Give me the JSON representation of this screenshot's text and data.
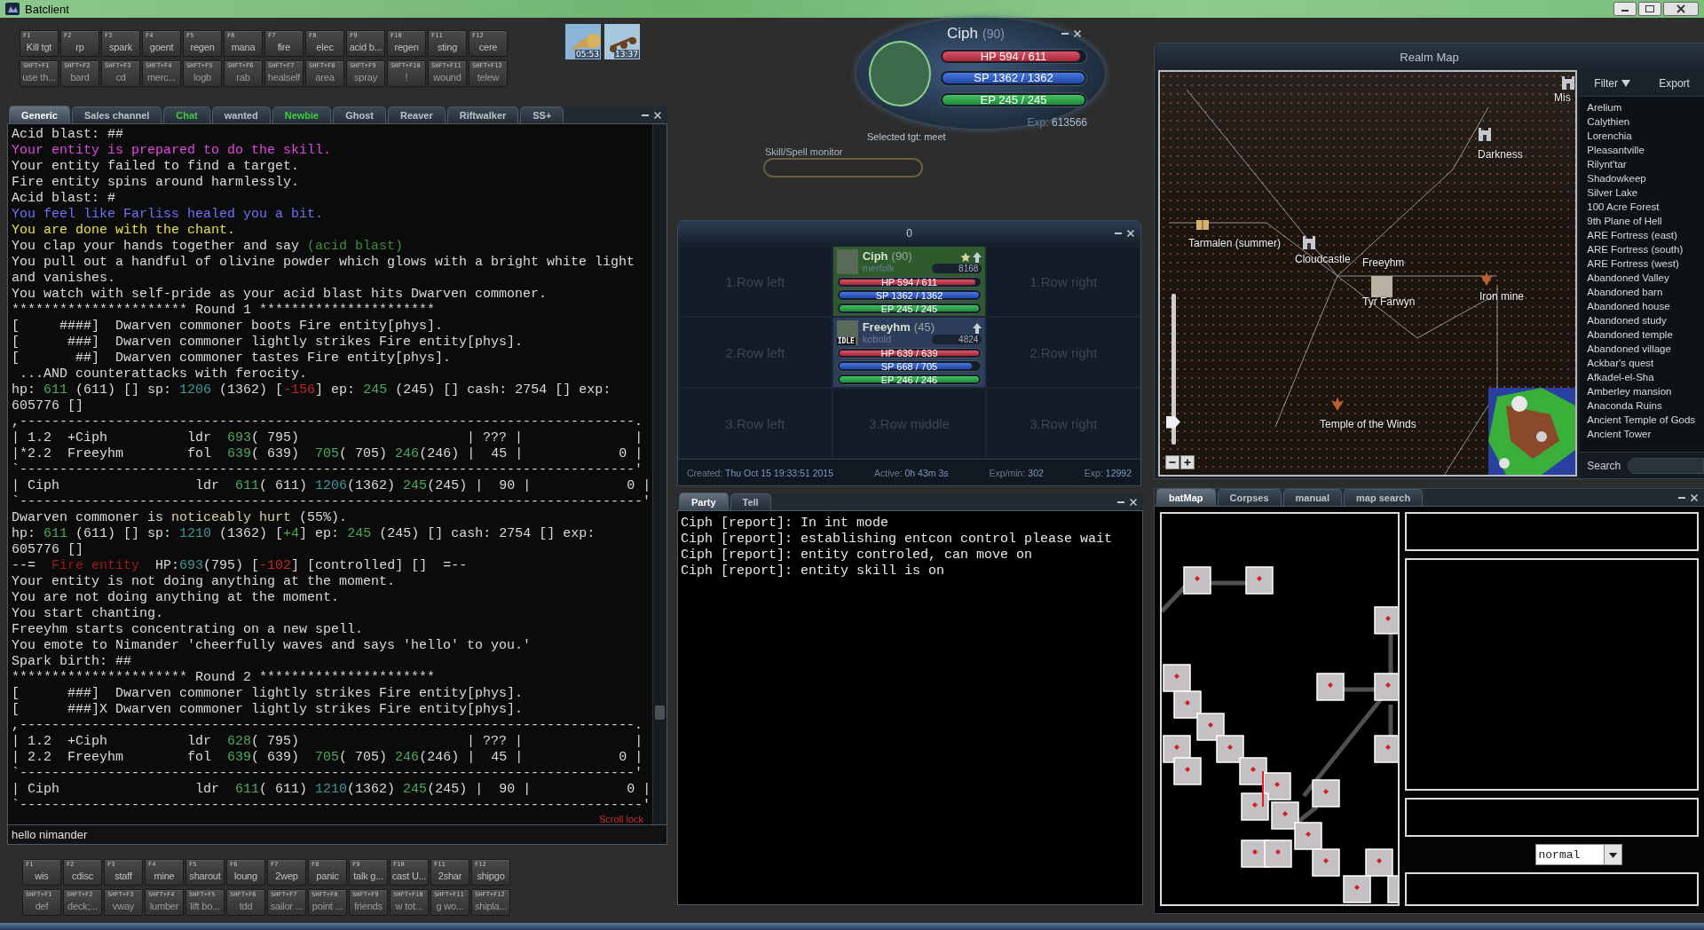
{
  "window": {
    "title": "Batclient"
  },
  "hotkeys_top": {
    "keys": [
      {
        "key": "F1",
        "label": "Kill tgt"
      },
      {
        "key": "F2",
        "label": "rp"
      },
      {
        "key": "F3",
        "label": "spark"
      },
      {
        "key": "F4",
        "label": "goent"
      },
      {
        "key": "F5",
        "label": "regen"
      },
      {
        "key": "F6",
        "label": "mana"
      },
      {
        "key": "F7",
        "label": "fire"
      },
      {
        "key": "F8",
        "label": "elec"
      },
      {
        "key": "F9",
        "label": "acid b..."
      },
      {
        "key": "F10",
        "label": "regen"
      },
      {
        "key": "F11",
        "label": "sting"
      },
      {
        "key": "F12",
        "label": "cere"
      }
    ],
    "shift_keys": [
      {
        "key": "SHFT+F1",
        "label": "use th..."
      },
      {
        "key": "SHFT+F2",
        "label": "bard"
      },
      {
        "key": "SHFT+F3",
        "label": "cd"
      },
      {
        "key": "SHFT+F4",
        "label": "merc..."
      },
      {
        "key": "SHFT+F5",
        "label": "logb"
      },
      {
        "key": "SHFT+F6",
        "label": "rab"
      },
      {
        "key": "SHFT+F7",
        "label": "healself"
      },
      {
        "key": "SHFT+F8",
        "label": "area"
      },
      {
        "key": "SHFT+F9",
        "label": "spray"
      },
      {
        "key": "SHFT+F10",
        "label": "!"
      },
      {
        "key": "SHFT+F11",
        "label": "wound"
      },
      {
        "key": "SHFT+F12",
        "label": "telew"
      }
    ]
  },
  "quick_icons": [
    {
      "timer": "05:53"
    },
    {
      "timer": "13:37"
    }
  ],
  "channel_tabs": [
    {
      "label": "Generic",
      "selected": true,
      "highlighted": false
    },
    {
      "label": "Sales channel",
      "selected": false,
      "highlighted": false
    },
    {
      "label": "Chat",
      "selected": false,
      "highlighted": true
    },
    {
      "label": "wanted",
      "selected": false,
      "highlighted": false
    },
    {
      "label": "Newbie",
      "selected": false,
      "highlighted": true
    },
    {
      "label": "Ghost",
      "selected": false,
      "highlighted": false
    },
    {
      "label": "Reaver",
      "selected": false,
      "highlighted": false
    },
    {
      "label": "Riftwalker",
      "selected": false,
      "highlighted": false
    },
    {
      "label": "SS+",
      "selected": false,
      "highlighted": false
    }
  ],
  "log": [
    [
      {
        "text": "Acid blast: ##"
      }
    ],
    [
      {
        "text": "Your entity is prepared to do the skill.",
        "color": "#e048e0"
      }
    ],
    [
      {
        "text": "Your entity failed to find a target."
      }
    ],
    [
      {
        "text": "Fire entity spins around harmlessly."
      }
    ],
    [
      {
        "text": "Acid blast: #"
      }
    ],
    [
      {
        "text": "You feel like Farliss healed you a bit.",
        "color": "#7070ff"
      }
    ],
    [
      {
        "text": "You are done with the chant.",
        "color": "#e8e040"
      }
    ],
    [
      {
        "text": "You clap your hands together and say "
      },
      {
        "text": "(acid blast)",
        "color": "#3c8c3c"
      }
    ],
    [
      {
        "text": "You pull out a handful of olivine powder which glows with a bright white light"
      }
    ],
    [
      {
        "text": "and vanishes."
      }
    ],
    [
      {
        "text": "You watch with self-pride as your acid blast hits Dwarven commoner."
      }
    ],
    [
      {
        "text": "********************** Round 1 **********************"
      }
    ],
    [
      {
        "text": "[     ####]  Dwarven commoner boots Fire entity[phys]."
      }
    ],
    [
      {
        "text": "[      ###]  Dwarven commoner lightly strikes Fire entity[phys]."
      }
    ],
    [
      {
        "text": "[       ##]  Dwarven commoner tastes Fire entity[phys]."
      }
    ],
    [
      {
        "text": " ...AND counterattacks with ferocity."
      }
    ],
    [
      {
        "text": "hp: "
      },
      {
        "text": "611",
        "color": "#4caa5c"
      },
      {
        "text": " (611) [] sp: "
      },
      {
        "text": "1206",
        "color": "#3a9a9a"
      },
      {
        "text": " (1362) ["
      },
      {
        "text": "-156",
        "color": "#c02828"
      },
      {
        "text": "] ep: "
      },
      {
        "text": "245",
        "color": "#4caa5c"
      },
      {
        "text": " (245) [] cash: 2754 [] exp:"
      }
    ],
    [
      {
        "text": "605776 []"
      }
    ],
    [
      {
        "text": ",-----------------------------------------------------------------------------."
      }
    ],
    [
      {
        "text": "| 1.2  +Ciph          ldr  "
      },
      {
        "text": "693",
        "color": "#4caa5c"
      },
      {
        "text": "( 795)                     | ??? |              |"
      }
    ],
    [
      {
        "text": "|*2.2  Freeyhm        fol  "
      },
      {
        "text": "639",
        "color": "#4caa5c"
      },
      {
        "text": "( 639)  "
      },
      {
        "text": "705",
        "color": "#4caa5c"
      },
      {
        "text": "( 705) "
      },
      {
        "text": "246",
        "color": "#4caa5c"
      },
      {
        "text": "(246) |  45 |            0 |"
      }
    ],
    [
      {
        "text": "`-----------------------------------------------------------------------------'"
      }
    ],
    [
      {
        "text": "| Ciph                 ldr  "
      },
      {
        "text": "611",
        "color": "#4caa5c"
      },
      {
        "text": "( 611) "
      },
      {
        "text": "1206",
        "color": "#3a9a9a"
      },
      {
        "text": "(1362) "
      },
      {
        "text": "245",
        "color": "#4caa5c"
      },
      {
        "text": "(245) |  90 |            0 |"
      }
    ],
    [
      {
        "text": "`------------------------------------------------------------------------------'"
      }
    ],
    [
      {
        "text": "Dwarven commoner is "
      },
      {
        "text": "noticeably hurt",
        "color": "#d8cfa8"
      },
      {
        "text": " (55%)."
      }
    ],
    [
      {
        "text": "hp: "
      },
      {
        "text": "611",
        "color": "#4caa5c"
      },
      {
        "text": " (611) [] sp: "
      },
      {
        "text": "1210",
        "color": "#3a9a9a"
      },
      {
        "text": " (1362) ["
      },
      {
        "text": "+4",
        "color": "#4caa5c"
      },
      {
        "text": "] ep: "
      },
      {
        "text": "245",
        "color": "#4caa5c"
      },
      {
        "text": " (245) [] cash: 2754 [] exp:"
      }
    ],
    [
      {
        "text": "605776 []"
      }
    ],
    [
      {
        "text": "--=  "
      },
      {
        "text": "Fire entity",
        "color": "#a01c1c"
      },
      {
        "text": "  HP:"
      },
      {
        "text": "693",
        "color": "#3a9a9a"
      },
      {
        "text": "(795) ["
      },
      {
        "text": "-102",
        "color": "#c02828"
      },
      {
        "text": "] [controlled] []  =--"
      }
    ],
    [
      {
        "text": "Your entity is not doing anything at the moment."
      }
    ],
    [
      {
        "text": "You are not doing anything at the moment."
      }
    ],
    [
      {
        "text": "You start chanting."
      }
    ],
    [
      {
        "text": "Freeyhm starts concentrating on a new spell."
      }
    ],
    [
      {
        "text": "You emote to Nimander 'cheerfully waves and says 'hello' to you.'"
      }
    ],
    [
      {
        "text": "Spark birth: ##"
      }
    ],
    [
      {
        "text": "********************** Round 2 **********************"
      }
    ],
    [
      {
        "text": "[      ###]  Dwarven commoner lightly strikes Fire entity[phys]."
      }
    ],
    [
      {
        "text": "[      ###]X Dwarven commoner lightly strikes Fire entity[phys]."
      }
    ],
    [
      {
        "text": ",-----------------------------------------------------------------------------."
      }
    ],
    [
      {
        "text": "| 1.2  +Ciph          ldr  "
      },
      {
        "text": "628",
        "color": "#4caa5c"
      },
      {
        "text": "( 795)                     | ??? |              |"
      }
    ],
    [
      {
        "text": "| 2.2  Freeyhm        fol  "
      },
      {
        "text": "639",
        "color": "#4caa5c"
      },
      {
        "text": "( 639)  "
      },
      {
        "text": "705",
        "color": "#4caa5c"
      },
      {
        "text": "( 705) "
      },
      {
        "text": "246",
        "color": "#4caa5c"
      },
      {
        "text": "(246) |  45 |            0 |"
      }
    ],
    [
      {
        "text": "`-----------------------------------------------------------------------------'"
      }
    ],
    [
      {
        "text": "| Ciph                 ldr  "
      },
      {
        "text": "611",
        "color": "#4caa5c"
      },
      {
        "text": "( 611) "
      },
      {
        "text": "1210",
        "color": "#3a9a9a"
      },
      {
        "text": "(1362) "
      },
      {
        "text": "245",
        "color": "#4caa5c"
      },
      {
        "text": "(245) |  90 |            0 |"
      }
    ],
    [
      {
        "text": "`------------------------------------------------------------------------------'"
      }
    ]
  ],
  "scroll_lock": "Scroll lock",
  "command_input": {
    "value": "hello nimander"
  },
  "hotkeys_bottom": {
    "keys": [
      {
        "key": "F1",
        "label": "wis"
      },
      {
        "key": "F2",
        "label": "cdisc"
      },
      {
        "key": "F3",
        "label": "staff"
      },
      {
        "key": "F4",
        "label": "mine"
      },
      {
        "key": "F5",
        "label": "sharout"
      },
      {
        "key": "F6",
        "label": "loung"
      },
      {
        "key": "F7",
        "label": "2wep"
      },
      {
        "key": "F8",
        "label": "panic"
      },
      {
        "key": "F9",
        "label": "talk g..."
      },
      {
        "key": "F10",
        "label": "cast U..."
      },
      {
        "key": "F11",
        "label": "2shar"
      },
      {
        "key": "F12",
        "label": "shipgo"
      }
    ],
    "shift_keys": [
      {
        "key": "SHFT+F1",
        "label": "def"
      },
      {
        "key": "SHFT+F2",
        "label": "deck;..."
      },
      {
        "key": "SHFT+F3",
        "label": "vway"
      },
      {
        "key": "SHFT+F4",
        "label": "lumber"
      },
      {
        "key": "SHFT+F5",
        "label": "lift bo..."
      },
      {
        "key": "SHFT+F6",
        "label": "tdd"
      },
      {
        "key": "SHFT+F7",
        "label": "sailor ..."
      },
      {
        "key": "SHFT+F8",
        "label": "point ..."
      },
      {
        "key": "SHFT+F9",
        "label": "friends"
      },
      {
        "key": "SHFT+F10",
        "label": "w tot..."
      },
      {
        "key": "SHFT+F11",
        "label": "g wo..."
      },
      {
        "key": "SHFT+F12",
        "label": "shipla..."
      }
    ]
  },
  "status": {
    "name": "Ciph",
    "level": "(90)",
    "bars": [
      {
        "kind": "hp",
        "label": "HP  594 / 611",
        "level": 0.97
      },
      {
        "kind": "sp",
        "label": "SP  1362 / 1362",
        "level": 1
      },
      {
        "kind": "ep",
        "label": "EP  245 / 245",
        "level": 1
      }
    ],
    "exp_label": "Exp:",
    "exp_value": "613566",
    "selected_target": "Selected tgt: meet",
    "skill_monitor_label": "Skill/Spell monitor"
  },
  "party_window": {
    "title": "0",
    "cells": [
      {
        "kind": "empty",
        "label": "1.Row left"
      },
      {
        "kind": "member",
        "name": "Ciph",
        "level": "(90)",
        "race": "merfolk",
        "exp": "8168",
        "leader": true,
        "color": "#2e5a2e",
        "bars": [
          {
            "kind": "hp",
            "label": "HP 594 / 611",
            "level": 0.97
          },
          {
            "kind": "sp",
            "label": "SP 1362 / 1362",
            "level": 1
          },
          {
            "kind": "ep",
            "label": "EP 245 / 245",
            "level": 1
          }
        ]
      },
      {
        "kind": "empty",
        "label": "1.Row right"
      },
      {
        "kind": "empty",
        "label": "2.Row left"
      },
      {
        "kind": "member",
        "name": "Freeyhm",
        "level": "(45)",
        "race": "kobold",
        "exp": "4824",
        "leader": false,
        "status_badge": "IDLE",
        "color": "#2c3e5c",
        "bars": [
          {
            "kind": "hp",
            "label": "HP 639 / 639",
            "level": 1
          },
          {
            "kind": "sp",
            "label": "SP 668 / 705",
            "level": 0.95
          },
          {
            "kind": "ep",
            "label": "EP 246 / 246",
            "level": 1
          }
        ]
      },
      {
        "kind": "empty",
        "label": "2.Row right"
      },
      {
        "kind": "empty",
        "label": "3.Row left"
      },
      {
        "kind": "empty",
        "label": "3.Row middle"
      },
      {
        "kind": "empty",
        "label": "3.Row right"
      }
    ],
    "footer": [
      {
        "label": "Created:",
        "value": "Thu Oct 15 19:33:51 2015"
      },
      {
        "label": "Active:",
        "value": "0h 43m 3s"
      },
      {
        "label": "Exp/min:",
        "value": "302"
      },
      {
        "label": "Exp:",
        "value": "12992"
      }
    ]
  },
  "chat_window": {
    "tabs": [
      {
        "label": "Party",
        "selected": true
      },
      {
        "label": "Tell",
        "selected": false
      }
    ],
    "lines": [
      "Ciph [report]: In int mode",
      "Ciph [report]: establishing entcon control please wait",
      "Ciph [report]: entity controled, can move on",
      "Ciph [report]: entity skill is on"
    ]
  },
  "realm_map": {
    "title": "Realm Map",
    "map_labels": [
      "Mis",
      "Darkness",
      "Tarmalen (summer)",
      "Cloudcastle",
      "Freeyhm",
      "Tyr Farwyn",
      "Iron mine",
      "Temple of the Winds"
    ],
    "zoom_slider": {
      "level": 0.15
    },
    "filter_button": "Filter",
    "export_button": "Export",
    "places": [
      "Arelium",
      "Calythien",
      "Lorenchia",
      "Pleasantville",
      "Rilynt'tar",
      "Shadowkeep",
      "Silver Lake",
      "100 Acre Forest",
      "9th Plane of Hell",
      "ARE Fortress (east)",
      "ARE Fortress (south)",
      "ARE Fortress (west)",
      "Abandoned Valley",
      "Abandoned barn",
      "Abandoned house",
      "Abandoned study",
      "Abandoned temple",
      "Abandoned village",
      "Ackbar's quest",
      "Afkadel-el-Sha",
      "Amberley mansion",
      "Anaconda Ruins",
      "Ancient Temple of Gods",
      "Ancient Tower"
    ],
    "search_label": "Search"
  },
  "batmap": {
    "tabs": [
      {
        "label": "batMap",
        "selected": true
      },
      {
        "label": "Corpses",
        "selected": false
      },
      {
        "label": "manual",
        "selected": false
      },
      {
        "label": "map search",
        "selected": false
      }
    ],
    "mode_select": {
      "value": "normal"
    }
  }
}
